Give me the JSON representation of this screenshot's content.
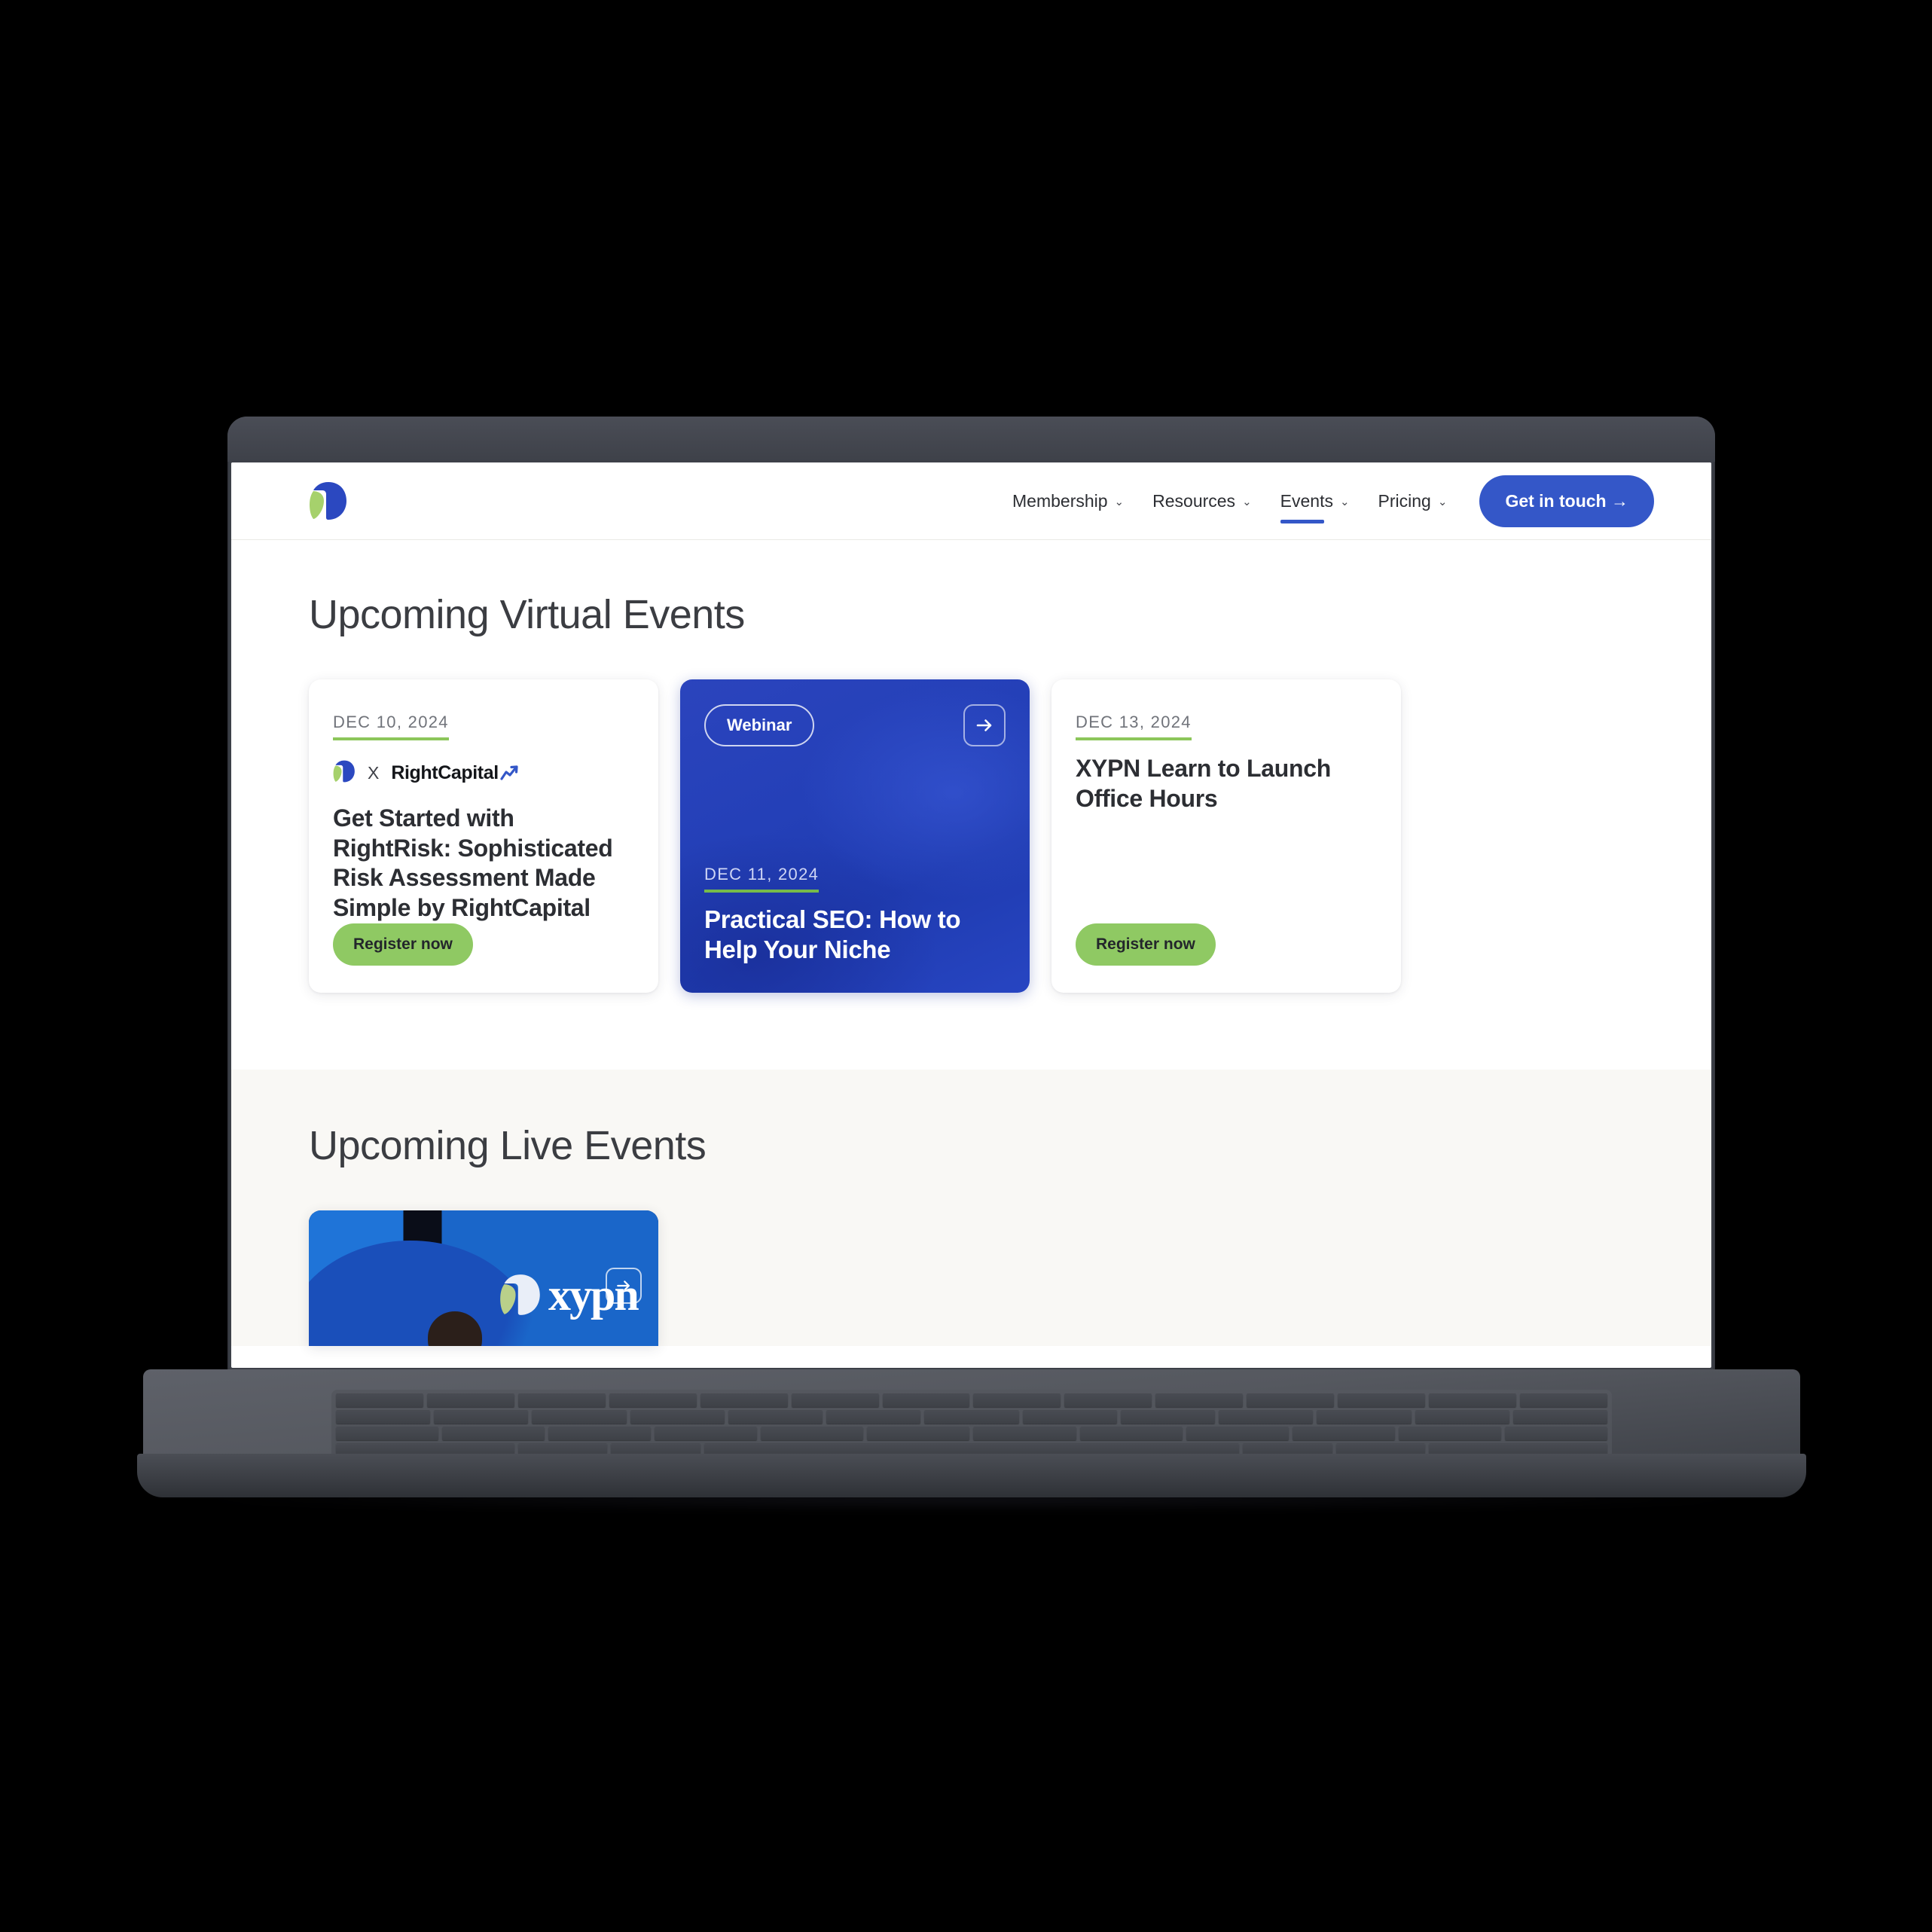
{
  "header": {
    "logo_name": "xypn-logo",
    "nav_items": [
      {
        "label": "Membership",
        "has_dropdown": true,
        "active": false
      },
      {
        "label": "Resources",
        "has_dropdown": true,
        "active": false
      },
      {
        "label": "Events",
        "has_dropdown": true,
        "active": true
      },
      {
        "label": "Pricing",
        "has_dropdown": true,
        "active": false
      }
    ],
    "cta_label": "Get in touch →"
  },
  "virtual_section": {
    "heading": "Upcoming Virtual Events",
    "cards": [
      {
        "style": "light",
        "date": "DEC 10, 2024",
        "partner_separator": "X",
        "partner_name": "RightCapital",
        "title": "Get Started with RightRisk: Sophisticated Risk Assessment Made Simple by RightCapital",
        "register_label": "Register now"
      },
      {
        "style": "featured",
        "badge": "Webinar",
        "date": "DEC 11, 2024",
        "title": "Practical SEO: How to Help Your Niche",
        "arrow_glyph": "→"
      },
      {
        "style": "light",
        "date": "DEC 13, 2024",
        "title": "XYPN Learn to Launch Office Hours",
        "register_label": "Register now"
      }
    ]
  },
  "live_section": {
    "heading": "Upcoming Live Events",
    "cards": [
      {
        "image_label": "xypn",
        "arrow_glyph": "→"
      }
    ]
  },
  "colors": {
    "brand_blue": "#3457c8",
    "card_blue": "#2440b8",
    "accent_green": "#8fc963",
    "underline_green": "#8cc65a",
    "page_white": "#ffffff",
    "section_cream": "#f9f8f5",
    "text_dark": "#2c2e33",
    "text_muted": "#70737a",
    "laptop_body": "#3e4149"
  }
}
